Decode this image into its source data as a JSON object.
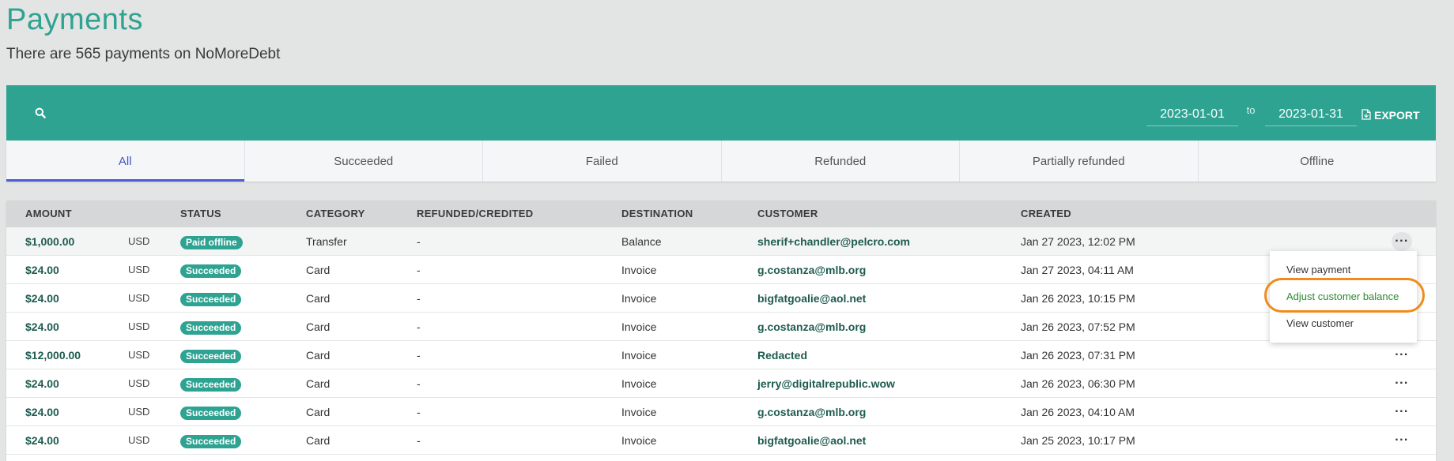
{
  "header": {
    "title": "Payments",
    "subtitle": "There are 565 payments on NoMoreDebt"
  },
  "toolbar": {
    "search_icon": "search-icon",
    "date_from": "2023-01-01",
    "date_separator": "to",
    "date_to": "2023-01-31",
    "export_label": "EXPORT",
    "export_icon": "file-export-icon",
    "accent_color": "#2ea392"
  },
  "tabs": [
    {
      "label": "All",
      "active": true
    },
    {
      "label": "Succeeded"
    },
    {
      "label": "Failed"
    },
    {
      "label": "Refunded"
    },
    {
      "label": "Partially refunded"
    },
    {
      "label": "Offline"
    }
  ],
  "table": {
    "columns": [
      "AMOUNT",
      "STATUS",
      "CATEGORY",
      "REFUNDED/CREDITED",
      "DESTINATION",
      "CUSTOMER",
      "CREATED"
    ],
    "rows": [
      {
        "amount": "$1,000.00",
        "currency": "USD",
        "status": "Paid offline",
        "category": "Transfer",
        "refunded": "-",
        "destination": "Balance",
        "customer": "sherif+chandler@pelcro.com",
        "created": "Jan 27 2023, 12:02 PM",
        "more": "···"
      },
      {
        "amount": "$24.00",
        "currency": "USD",
        "status": "Succeeded",
        "category": "Card",
        "refunded": "-",
        "destination": "Invoice",
        "customer": "g.costanza@mlb.org",
        "created": "Jan 27 2023, 04:11 AM",
        "more": ""
      },
      {
        "amount": "$24.00",
        "currency": "USD",
        "status": "Succeeded",
        "category": "Card",
        "refunded": "-",
        "destination": "Invoice",
        "customer": "bigfatgoalie@aol.net",
        "created": "Jan 26 2023, 10:15 PM",
        "more": ""
      },
      {
        "amount": "$24.00",
        "currency": "USD",
        "status": "Succeeded",
        "category": "Card",
        "refunded": "-",
        "destination": "Invoice",
        "customer": "g.costanza@mlb.org",
        "created": "Jan 26 2023, 07:52 PM",
        "more": ""
      },
      {
        "amount": "$12,000.00",
        "currency": "USD",
        "status": "Succeeded",
        "category": "Card",
        "refunded": "-",
        "destination": "Invoice",
        "customer": "Redacted",
        "created": "Jan 26 2023, 07:31 PM",
        "more": "···"
      },
      {
        "amount": "$24.00",
        "currency": "USD",
        "status": "Succeeded",
        "category": "Card",
        "refunded": "-",
        "destination": "Invoice",
        "customer": "jerry@digitalrepublic.wow",
        "created": "Jan 26 2023, 06:30 PM",
        "more": "···"
      },
      {
        "amount": "$24.00",
        "currency": "USD",
        "status": "Succeeded",
        "category": "Card",
        "refunded": "-",
        "destination": "Invoice",
        "customer": "g.costanza@mlb.org",
        "created": "Jan 26 2023, 04:10 AM",
        "more": "···"
      },
      {
        "amount": "$24.00",
        "currency": "USD",
        "status": "Succeeded",
        "category": "Card",
        "refunded": "-",
        "destination": "Invoice",
        "customer": "bigfatgoalie@aol.net",
        "created": "Jan 25 2023, 10:17 PM",
        "more": "···"
      }
    ]
  },
  "dropdown": {
    "items": [
      "View payment",
      "Adjust customer balance",
      "View customer"
    ],
    "highlight_color": "#f08b1c"
  }
}
